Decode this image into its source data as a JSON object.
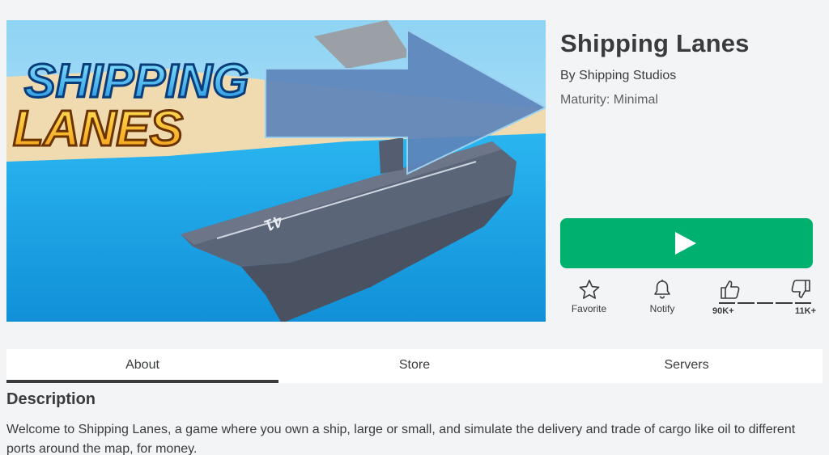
{
  "game": {
    "title": "Shipping Lanes",
    "by_prefix": "By ",
    "creator": "Shipping Studios",
    "maturity": "Maturity: Minimal",
    "thumbnail_logo_line1": "SHIPPING",
    "thumbnail_logo_line2": "LANES",
    "thumbnail_hull_number": "41"
  },
  "actions": {
    "favorite": "Favorite",
    "notify": "Notify",
    "likes": "90K+",
    "dislikes": "11K+",
    "play_icon": "play-icon",
    "favorite_icon": "star-icon",
    "notify_icon": "bell-icon",
    "like_icon": "thumbs-up-icon",
    "dislike_icon": "thumbs-down-icon"
  },
  "tabs": [
    {
      "label": "About",
      "active": true
    },
    {
      "label": "Store",
      "active": false
    },
    {
      "label": "Servers",
      "active": false
    }
  ],
  "description": {
    "heading": "Description",
    "text": "Welcome to Shipping Lanes, a game where you own a ship, large or small, and simulate the delivery and trade of cargo like oil to different ports around the map, for money."
  },
  "colors": {
    "play_button": "#00b06f",
    "background": "#f2f4f5",
    "text": "#393b3d"
  }
}
